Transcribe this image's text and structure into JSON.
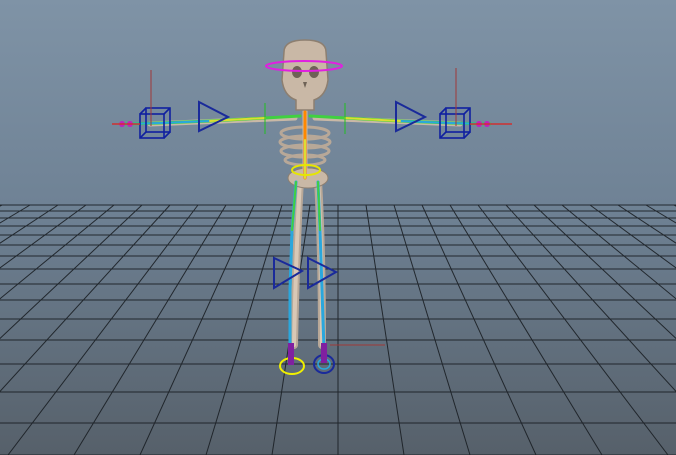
{
  "viewport": {
    "view": "perspective",
    "background_gradient": [
      "#7f93a6",
      "#56606a"
    ],
    "grid": {
      "visible": true,
      "color": "#1a1f24"
    },
    "character": {
      "type": "skeleton",
      "pose": "T-pose",
      "bone_color": "#c9b8a6",
      "joint_chain_colors": [
        "#2ad",
        "#3c6",
        "#dd3",
        "#f80"
      ]
    }
  },
  "rig_controls": {
    "head_control": {
      "color": "#e020e0",
      "icon": "ring-icon"
    },
    "hip_control": {
      "color": "#e6e600",
      "icon": "ring-icon"
    },
    "wrist_controls": {
      "color": "#1020a0",
      "icon": "cube-icon"
    },
    "ik_handles": {
      "color": "#1a2a9a",
      "icon": "cone-arrow-icon"
    },
    "foot_controls": {
      "left_color": "#f0f000",
      "right_color": "#1a2a9a",
      "icon": "ring-icon"
    },
    "locator_color": "#d03030",
    "pole_color": "#20c020"
  }
}
